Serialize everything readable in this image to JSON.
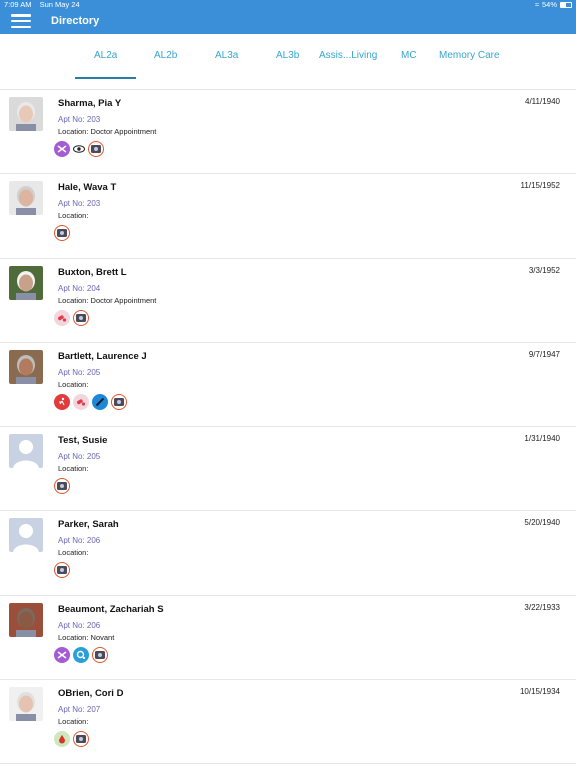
{
  "status_bar": {
    "time": "7:09 AM",
    "date": "Sun May 24",
    "battery": "54%"
  },
  "header": {
    "title": "Directory"
  },
  "tabs": [
    {
      "label": "AL2a",
      "selected": true
    },
    {
      "label": "AL2b",
      "selected": false
    },
    {
      "label": "AL3a",
      "selected": false
    },
    {
      "label": "AL3b",
      "selected": false
    },
    {
      "label": "Assis...Living",
      "selected": false
    },
    {
      "label": "MC",
      "selected": false
    },
    {
      "label": "Memory Care",
      "selected": false
    }
  ],
  "residents": [
    {
      "name": "Sharma, Pia Y",
      "apt": "Apt No: 203",
      "location": "Location: Doctor Appointment",
      "dob": "4/11/1940",
      "avatar": "photo",
      "icons": [
        "scissors-icon",
        "eye-icon",
        "camera-icon"
      ]
    },
    {
      "name": "Hale, Wava T",
      "apt": "Apt No: 203",
      "location": "Location:",
      "dob": "11/15/1952",
      "avatar": "photo",
      "icons": [
        "camera-icon"
      ]
    },
    {
      "name": "Buxton, Brett L",
      "apt": "Apt No: 204",
      "location": "Location: Doctor Appointment",
      "dob": "3/3/1952",
      "avatar": "photo",
      "icons": [
        "pill-icon",
        "camera-icon"
      ]
    },
    {
      "name": "Bartlett, Laurence J",
      "apt": "Apt No: 205",
      "location": "Location:",
      "dob": "9/7/1947",
      "avatar": "photo",
      "icons": [
        "fall-risk-icon",
        "pill-icon",
        "syringe-icon",
        "camera-icon"
      ]
    },
    {
      "name": "Test, Susie",
      "apt": "Apt No: 205",
      "location": "Location:",
      "dob": "1/31/1940",
      "avatar": "placeholder",
      "icons": [
        "camera-icon"
      ]
    },
    {
      "name": "Parker, Sarah",
      "apt": "Apt No: 206",
      "location": "Location:",
      "dob": "5/20/1940",
      "avatar": "placeholder",
      "icons": [
        "camera-icon"
      ]
    },
    {
      "name": "Beaumont, Zachariah S",
      "apt": "Apt No: 206",
      "location": "Location: Novant",
      "dob": "3/22/1933",
      "avatar": "photo",
      "icons": [
        "scissors-icon",
        "oxygen-icon",
        "camera-icon"
      ]
    },
    {
      "name": "OBrien, Cori D",
      "apt": "Apt No: 207",
      "location": "Location:",
      "dob": "10/15/1934",
      "avatar": "photo",
      "icons": [
        "blood-drop-icon",
        "camera-icon"
      ]
    }
  ],
  "colors": {
    "header_bg": "#3a8fd8",
    "tab_text": "#37a6cf",
    "apt_text": "#6a66b5"
  }
}
